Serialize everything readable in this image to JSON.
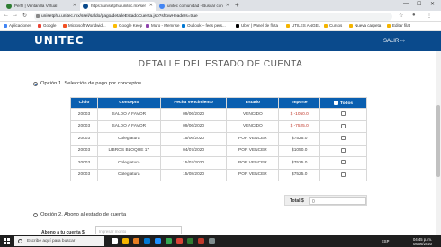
{
  "browser": {
    "tabs": [
      {
        "label": "Perfil | Ventanilla Virtual",
        "color": "#2e7d32"
      },
      {
        "label": "https://unisetphu.unitec.mx/ser",
        "color": "#0a4a8c"
      },
      {
        "label": "unitec comunidad - Buscar con",
        "color": "#4285f4"
      }
    ],
    "new_tab": "+",
    "window_controls": [
      "—",
      "☐",
      "✕"
    ],
    "url": "unisetphu.unitec.mx/ssel/saldo/pago/detalleEstadoCuenta.jsp?showHeaders=true",
    "bookmarks": [
      {
        "label": "Aplicaciones",
        "color": "#4285f4"
      },
      {
        "label": "Google",
        "color": "#ea4335"
      },
      {
        "label": "Microsoft Worldwid...",
        "color": "#f25022"
      },
      {
        "label": "Google Keep",
        "color": "#fbbc04"
      },
      {
        "label": "Muro - Memrise",
        "color": "#8e44ad"
      },
      {
        "label": "Outlook – fees pers...",
        "color": "#0078d4"
      },
      {
        "label": "Uber | Panel de flota",
        "color": "#000000"
      },
      {
        "label": "UTILES ANGEL",
        "color": "#f4b400"
      },
      {
        "label": "Cursos",
        "color": "#f4b400"
      },
      {
        "label": "Nueva carpeta",
        "color": "#f4b400"
      },
      {
        "label": "Editar filat",
        "color": "#f4b400"
      }
    ]
  },
  "header": {
    "logo": "UNITEC",
    "logout_label": "SALIR ⇨"
  },
  "page": {
    "title": "DETALLE DEL ESTADO DE CUENTA",
    "option1_label": "Opción 1. Selección de pago por conceptos",
    "option2_label": "Opción 2. Abono al estado de cuenta",
    "abono_label": "Abono a tu cuenta $",
    "abono_placeholder": "Ingresar monto",
    "total_label": "Total $",
    "total_value": "0"
  },
  "table": {
    "headers": [
      "Ciclo",
      "Concepto",
      "Fecha Vencimiento",
      "Estado",
      "Importe",
      "Todos"
    ],
    "rows": [
      {
        "ciclo": "20003",
        "concepto": "SALDO A FAVOR",
        "fecha": "09/06/2020",
        "estado": "VENCIDO",
        "importe": "$ -1050.0",
        "negative": true
      },
      {
        "ciclo": "20003",
        "concepto": "SALDO A FAVOR",
        "fecha": "09/06/2020",
        "estado": "VENCIDO",
        "importe": "$ -7525.0",
        "negative": true
      },
      {
        "ciclo": "20003",
        "concepto": "Colegiatura",
        "fecha": "15/06/2020",
        "estado": "POR VENCER",
        "importe": "$7525.0",
        "negative": false
      },
      {
        "ciclo": "20003",
        "concepto": "LIBROS BLOQUE 17",
        "fecha": "04/07/2020",
        "estado": "POR VENCER",
        "importe": "$1050.0",
        "negative": false
      },
      {
        "ciclo": "20003",
        "concepto": "Colegiatura",
        "fecha": "15/07/2020",
        "estado": "POR VENCER",
        "importe": "$7525.0",
        "negative": false
      },
      {
        "ciclo": "20003",
        "concepto": "Colegiatura",
        "fecha": "15/08/2020",
        "estado": "POR VENCER",
        "importe": "$7525.0",
        "negative": false
      }
    ]
  },
  "taskbar": {
    "search_placeholder": "Escribe aquí para buscar",
    "app_colors": [
      "#ffffff",
      "#f4b400",
      "#e67e22",
      "#0078d4",
      "#1e90ff",
      "#34a853",
      "#db4437",
      "#2e7d32",
      "#c0392b",
      "#7f8c8d"
    ],
    "lang": "ESP",
    "time": "04:45 p. m.",
    "date": "08/06/2020"
  }
}
